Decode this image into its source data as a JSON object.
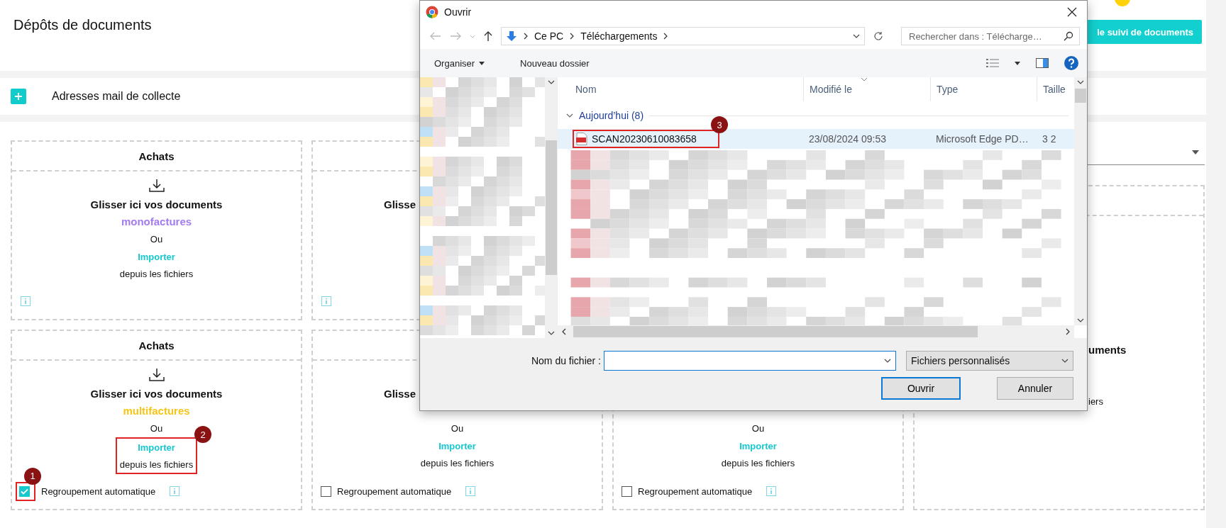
{
  "header": {
    "title": "Dépôts de documents",
    "action_button": "le suivi de documents"
  },
  "collect": {
    "label": "Adresses mail de collecte"
  },
  "rows": [
    [
      {
        "kind": "full",
        "title": "Achats",
        "drop_text": "Glisser ici vos documents",
        "doc_type": {
          "text": "monofactures",
          "color": "#a47cf2"
        },
        "or_text": "Ou",
        "import_link": "Importer",
        "import_note": "depuis les fichiers"
      },
      {
        "kind": "covered",
        "drop_text": "Glisse"
      }
    ],
    [
      {
        "kind": "full",
        "title": "Achats",
        "drop_text": "Glisser ici vos documents",
        "doc_type": {
          "text": "multifactures",
          "color": "#f5c518"
        },
        "or_text": "Ou",
        "import_link": "Importer",
        "import_note": "depuis les fichiers",
        "import_callout": "2",
        "grouping": {
          "label": "Regroupement automatique",
          "checked": true,
          "callout": "1"
        }
      },
      {
        "kind": "covered",
        "drop_text": "Glisse",
        "or_text": "Ou",
        "import_link": "Importer",
        "import_note": "depuis les fichiers",
        "grouping": {
          "label": "Regroupement automatique",
          "checked": false
        }
      },
      {
        "kind": "covered",
        "or_text": "Ou",
        "import_link": "Importer",
        "import_note": "depuis les fichiers",
        "grouping": {
          "label": "Regroupement automatique",
          "checked": false
        }
      }
    ]
  ],
  "side_panel": {
    "heading": "uments",
    "note": "iers"
  },
  "dialog": {
    "title": "Ouvrir",
    "path": [
      "Ce PC",
      "Téléchargements"
    ],
    "search_placeholder": "Rechercher dans : Télécharge…",
    "organize": "Organiser",
    "new_folder": "Nouveau dossier",
    "columns": [
      "Nom",
      "Modifié le",
      "Type",
      "Taille"
    ],
    "group": {
      "label": "Aujourd’hui (8)",
      "expanded": true
    },
    "files": [
      {
        "name": "SCAN20230610083658",
        "modified": "23/08/2024 09:53",
        "type": "Microsoft Edge PD…",
        "size": "3 2",
        "selected": true,
        "callout": "3"
      }
    ],
    "filename_label": "Nom du fichier :",
    "filter": "Fichiers personnalisés",
    "buttons": [
      "Ouvrir",
      "Annuler"
    ]
  }
}
